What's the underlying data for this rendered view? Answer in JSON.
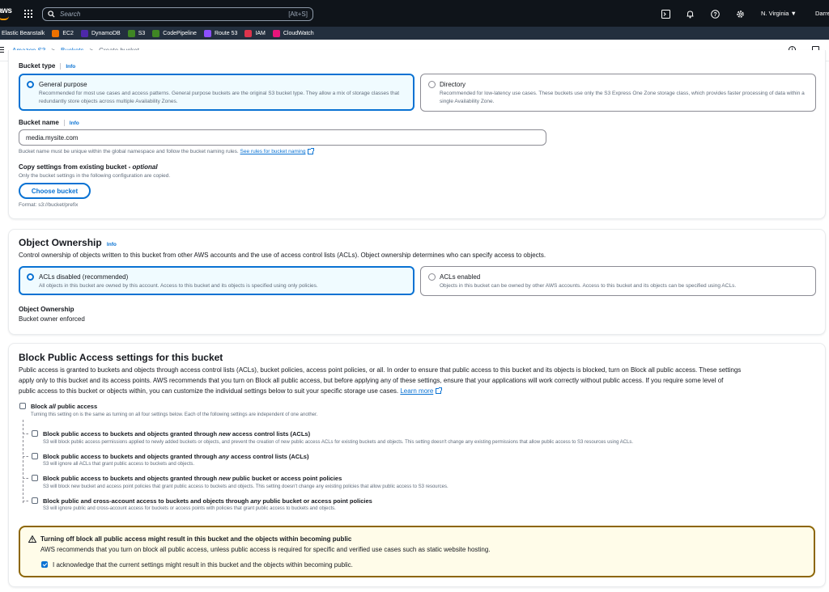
{
  "topnav": {
    "logo_text": "aws",
    "search_placeholder": "Search",
    "search_shortcut": "[Alt+S]",
    "region": "N. Virginia ▼",
    "user": "Darre"
  },
  "favorites": [
    {
      "label": "Elastic Beanstalk",
      "color": ""
    },
    {
      "label": "EC2",
      "color": "#ed7100"
    },
    {
      "label": "DynamoDB",
      "color": "#4d27aa"
    },
    {
      "label": "S3",
      "color": "#3f8624"
    },
    {
      "label": "CodePipeline",
      "color": "#3f8624"
    },
    {
      "label": "Route 53",
      "color": "#8c4fff"
    },
    {
      "label": "IAM",
      "color": "#dd344c"
    },
    {
      "label": "CloudWatch",
      "color": "#e7157b"
    }
  ],
  "breadcrumb": {
    "items": [
      "Amazon S3",
      "Buckets"
    ],
    "current": "Create bucket"
  },
  "general": {
    "bucket_type_label": "Bucket type",
    "info": "Info",
    "tiles": [
      {
        "title": "General purpose",
        "desc": "Recommended for most use cases and access patterns. General purpose buckets are the original S3 bucket type. They allow a mix of storage classes that redundantly store objects across multiple Availability Zones."
      },
      {
        "title": "Directory",
        "desc": "Recommended for low-latency use cases. These buckets use only the S3 Express One Zone storage class, which provides faster processing of data within a single Availability Zone."
      }
    ],
    "bucket_name_label": "Bucket name",
    "bucket_name_value": "media.mysite.com",
    "bucket_name_help": "Bucket name must be unique within the global namespace and follow the bucket naming rules.",
    "bucket_name_link": "See rules for bucket naming",
    "copy_label": "Copy settings from existing bucket - ",
    "copy_optional": "optional",
    "copy_help": "Only the bucket settings in the following configuration are copied.",
    "choose_bucket": "Choose bucket",
    "format_help": "Format: s3://bucket/prefix"
  },
  "ownership": {
    "title": "Object Ownership",
    "info": "Info",
    "desc": "Control ownership of objects written to this bucket from other AWS accounts and the use of access control lists (ACLs). Object ownership determines who can specify access to objects.",
    "tiles": [
      {
        "title": "ACLs disabled (recommended)",
        "desc": "All objects in this bucket are owned by this account. Access to this bucket and its objects is specified using only policies."
      },
      {
        "title": "ACLs enabled",
        "desc": "Objects in this bucket can be owned by other AWS accounts. Access to this bucket and its objects can be specified using ACLs."
      }
    ],
    "kv_label": "Object Ownership",
    "kv_value": "Bucket owner enforced"
  },
  "bpa": {
    "title": "Block Public Access settings for this bucket",
    "desc_line1": "Public access is granted to buckets and objects through access control lists (ACLs), bucket policies, access point policies, or all. In order to ensure that public access to this bucket and its objects is blocked, turn on Block all public access. These settings",
    "desc_line2": "apply only to this bucket and its access points. AWS recommends that you turn on Block all public access, but before applying any of these settings, ensure that your applications will work correctly without public access. If you require some level of",
    "desc_line3": "public access to this bucket or objects within, you can customize the individual settings below to suit your specific storage use cases.",
    "learn_more": "Learn more",
    "all": {
      "label_pre": "Block ",
      "label_em": "all",
      "label_post": " public access",
      "desc": "Turning this setting on is the same as turning on all four settings below. Each of the following settings are independent of one another."
    },
    "items": [
      {
        "pre": "Block public access to buckets and objects granted through ",
        "em": "new",
        "post": " access control lists (ACLs)",
        "desc": "S3 will block public access permissions applied to newly added buckets or objects, and prevent the creation of new public access ACLs for existing buckets and objects. This setting doesn't change any existing permissions that allow public access to S3 resources using ACLs."
      },
      {
        "pre": "Block public access to buckets and objects granted through ",
        "em": "any",
        "post": " access control lists (ACLs)",
        "desc": "S3 will ignore all ACLs that grant public access to buckets and objects."
      },
      {
        "pre": "Block public access to buckets and objects granted through ",
        "em": "new",
        "post": " public bucket or access point policies",
        "desc": "S3 will block new bucket and access point policies that grant public access to buckets and objects. This setting doesn't change any existing policies that allow public access to S3 resources."
      },
      {
        "pre": "Block public and cross-account access to buckets and objects through ",
        "em": "any",
        "post": " public bucket or access point policies",
        "desc": "S3 will ignore public and cross-account access for buckets or access points with policies that grant public access to buckets and objects."
      }
    ],
    "warning": {
      "title": "Turning off block all public access might result in this bucket and the objects within becoming public",
      "desc": "AWS recommends that you turn on block all public access, unless public access is required for specific and verified use cases such as static website hosting.",
      "ack": "I acknowledge that the current settings might result in this bucket and the objects within becoming public."
    }
  },
  "colors": {
    "accent": "#0972d3",
    "nav_bg": "#0f141a",
    "favbar_bg": "#232f3e",
    "warning_border": "#8d6605",
    "warning_bg": "#fffce9"
  }
}
